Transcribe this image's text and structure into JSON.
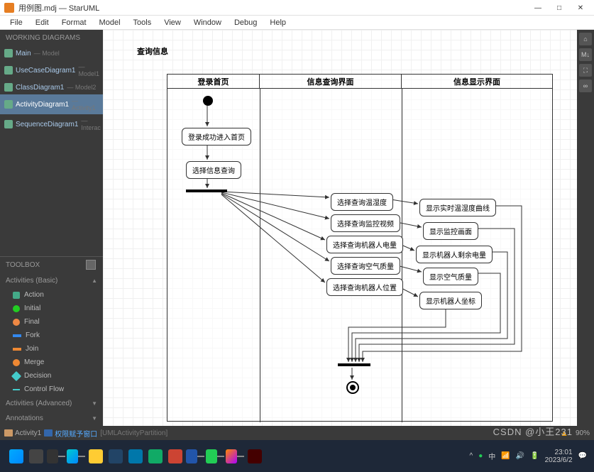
{
  "window": {
    "title": "用例图.mdj — StarUML",
    "minimize": "—",
    "maximize": "□",
    "close": "✕"
  },
  "menu": {
    "file": "File",
    "edit": "Edit",
    "format": "Format",
    "model": "Model",
    "tools": "Tools",
    "view": "View",
    "window": "Window",
    "debug": "Debug",
    "help": "Help"
  },
  "sidebar": {
    "working_header": "WORKING DIAGRAMS",
    "diagrams": [
      {
        "name": "Main",
        "meta": "— Model"
      },
      {
        "name": "UseCaseDiagram1",
        "meta": "— Model1"
      },
      {
        "name": "ClassDiagram1",
        "meta": "— Model2"
      },
      {
        "name": "ActivityDiagram1",
        "meta": "— Activity1"
      },
      {
        "name": "SequenceDiagram1",
        "meta": "— Interac"
      }
    ],
    "toolbox_header": "TOOLBOX",
    "basic_header": "Activities (Basic)",
    "advanced_header": "Activities (Advanced)",
    "annotations_header": "Annotations",
    "tools": {
      "action": "Action",
      "initial": "Initial",
      "final": "Final",
      "fork": "Fork",
      "join": "Join",
      "merge": "Merge",
      "decision": "Decision",
      "control_flow": "Control Flow"
    }
  },
  "diagram": {
    "title": "查询信息",
    "lanes": [
      "登录首页",
      "信息查询界面",
      "信息显示界面"
    ],
    "actions": {
      "login_success": "登录成功进入首页",
      "select_info_query": "选择信息查询",
      "q_temp_humid": "选择查询温湿度",
      "q_monitor_video": "选择查询监控视频",
      "q_robot_power": "选择查询机器人电量",
      "q_air_quality": "选择查询空气质量",
      "q_robot_pos": "选择查询机器人位置",
      "show_temp_curve": "显示实时温湿度曲线",
      "show_monitor": "显示监控画面",
      "show_robot_power": "显示机器人剩余电量",
      "show_air_quality": "显示空气质量",
      "show_robot_coord": "显示机器人坐标"
    }
  },
  "statusbar": {
    "activity": "Activity1",
    "partition": "权限赋予窗口",
    "type": "[UMLActivityPartition]",
    "zoom": "90%"
  },
  "taskbar": {
    "lang": "中",
    "time": "23:01",
    "date": "2023/6/2"
  },
  "watermark": "CSDN @小王231"
}
